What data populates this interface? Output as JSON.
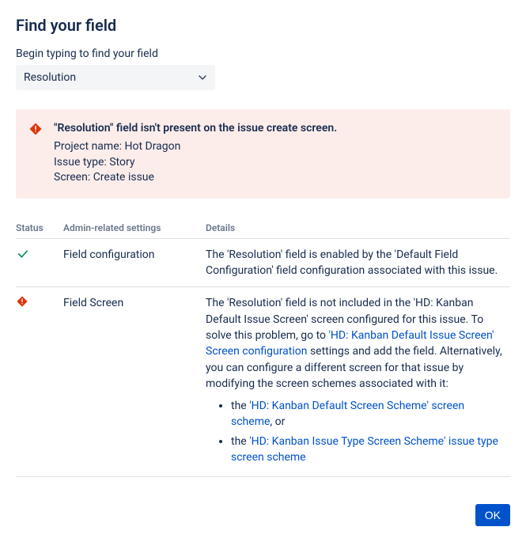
{
  "title": "Find your field",
  "field_label": "Begin typing to find your field",
  "selected_field": "Resolution",
  "alert": {
    "title": "\"Resolution\" field isn't present on the issue create screen.",
    "project_line": "Project name: Hot Dragon",
    "issue_line": "Issue type: Story",
    "screen_line": "Screen: Create issue"
  },
  "columns": {
    "status": "Status",
    "admin": "Admin-related settings",
    "details": "Details"
  },
  "rows": [
    {
      "status": "ok",
      "admin": "Field configuration",
      "details_text": "The 'Resolution' field is enabled by the 'Default Field Configuration' field configuration associated with this issue."
    },
    {
      "status": "error",
      "admin": "Field Screen",
      "details_pre": "The 'Resolution' field is not included in the 'HD: Kanban Default Issue Screen' screen configured for this issue. To solve this problem, go to ",
      "details_link1": "'HD: Kanban Default Issue Screen' Screen configuration",
      "details_post": " settings and add the field. Alternatively, you can configure a different screen for that issue by modifying the screen schemes associated with it:",
      "bullet1_pre": "the ",
      "bullet1_link": "'HD: Kanban Default Screen Scheme' screen scheme",
      "bullet1_post": ", or",
      "bullet2_pre": "the ",
      "bullet2_link": "'HD: Kanban Issue Type Screen Scheme' issue type screen scheme"
    }
  ],
  "ok_label": "OK"
}
